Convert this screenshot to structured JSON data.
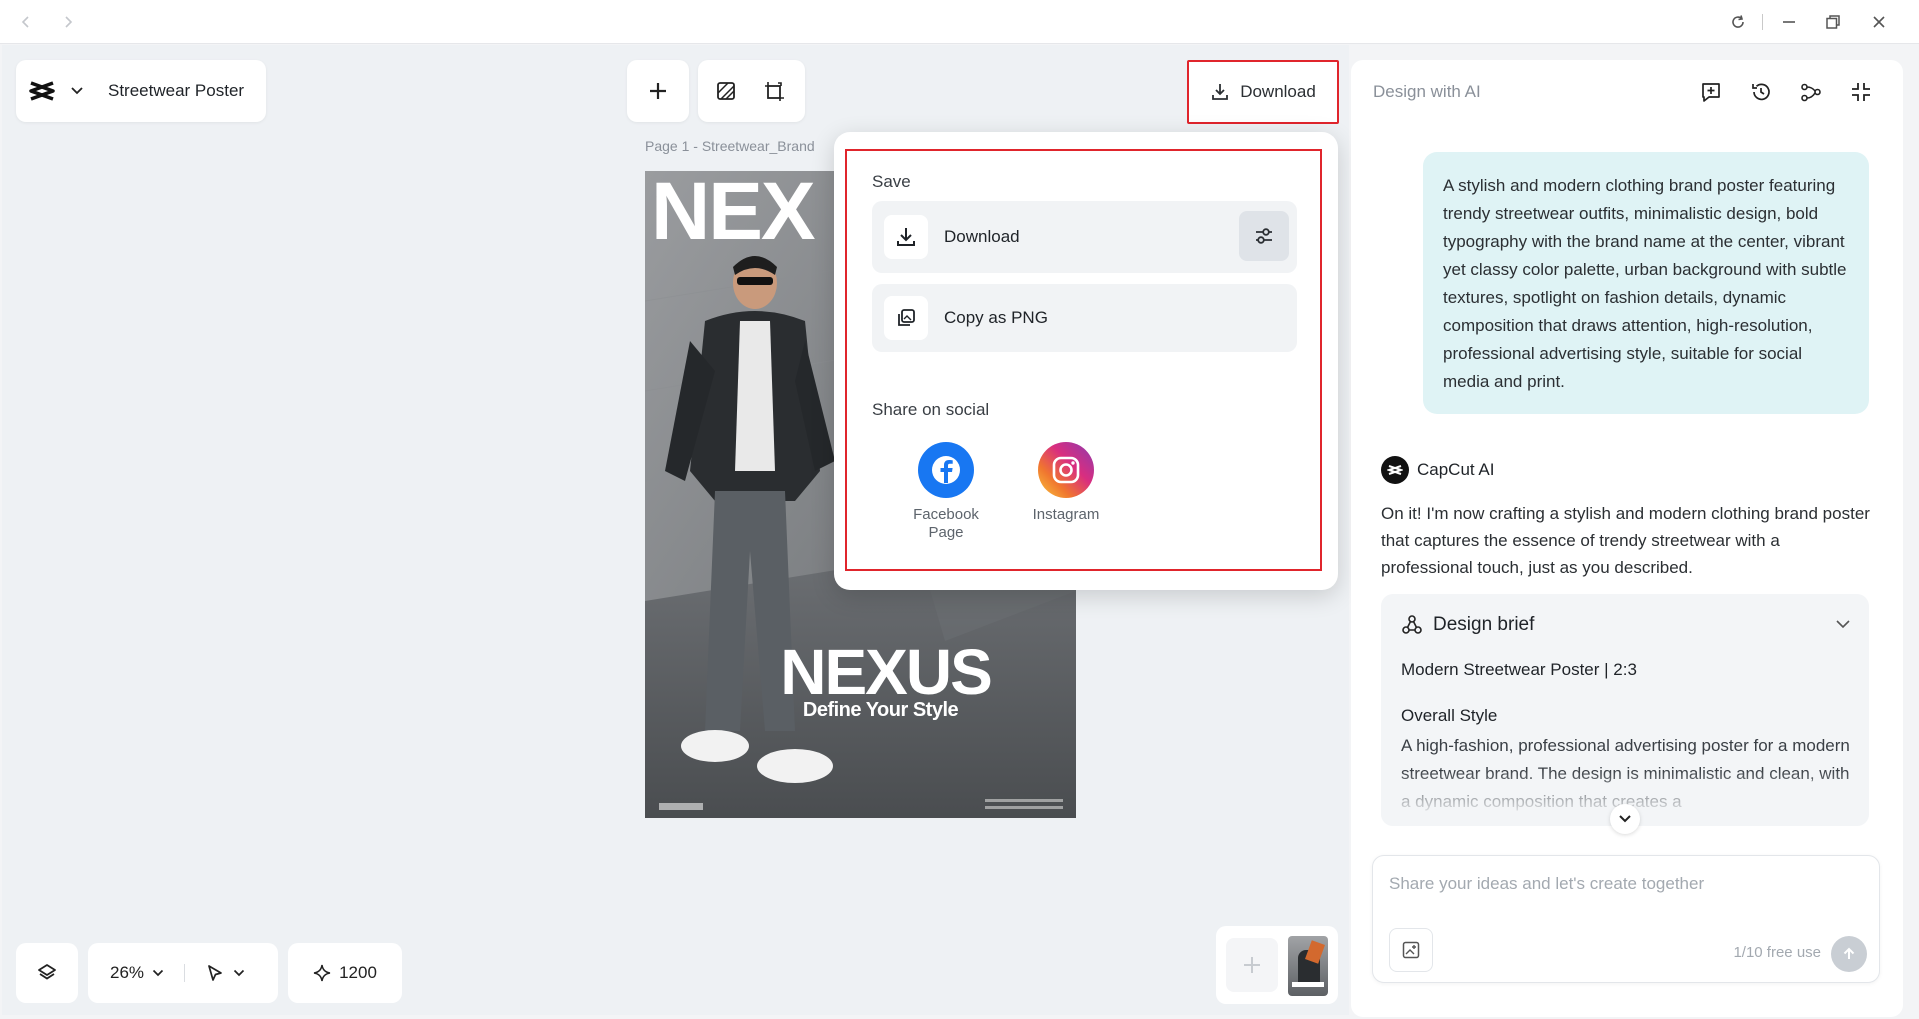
{
  "project": {
    "name": "Streetwear Poster"
  },
  "header": {
    "download_label": "Download"
  },
  "canvas": {
    "page_label": "Page 1 -   Streetwear_Brand"
  },
  "poster": {
    "top_text": "NEX",
    "brand": "NEXUS",
    "tagline": "Define Your Style"
  },
  "popover": {
    "save_label": "Save",
    "download_label": "Download",
    "copy_label": "Copy as PNG",
    "share_label": "Share on social",
    "socials": [
      {
        "label": "Facebook Page",
        "icon": "facebook-icon"
      },
      {
        "label": "Instagram",
        "icon": "instagram-icon"
      }
    ]
  },
  "bottom_toolbar": {
    "zoom": "26%",
    "credits": "1200"
  },
  "ai_panel": {
    "title": "Design with AI",
    "user_prompt": "A stylish and modern clothing brand poster featuring trendy streetwear outfits, minimalistic design, bold typography with the brand name at the center, vibrant yet classy color palette, urban background with subtle textures, spotlight on fashion details, dynamic composition that draws attention, high-resolution, professional advertising style, suitable for social media and print.",
    "assistant_name": "CapCut AI",
    "assistant_reply": "On it! I'm now crafting a stylish and modern clothing brand poster that captures the essence of trendy streetwear with a professional touch, just as you described.",
    "brief": {
      "title": "Design brief",
      "subtitle": "Modern Streetwear Poster | 2:3",
      "style_heading": "Overall Style",
      "style_text": "A high-fashion, professional advertising poster for a modern streetwear brand. The design is minimalistic and clean, with a dynamic composition that creates a"
    },
    "input_placeholder": "Share your ideas and let's create together",
    "free_use": "1/10 free use"
  },
  "colors": {
    "highlight": "#e0252c",
    "bubble": "#dff3f5",
    "facebook": "#1877f2"
  }
}
